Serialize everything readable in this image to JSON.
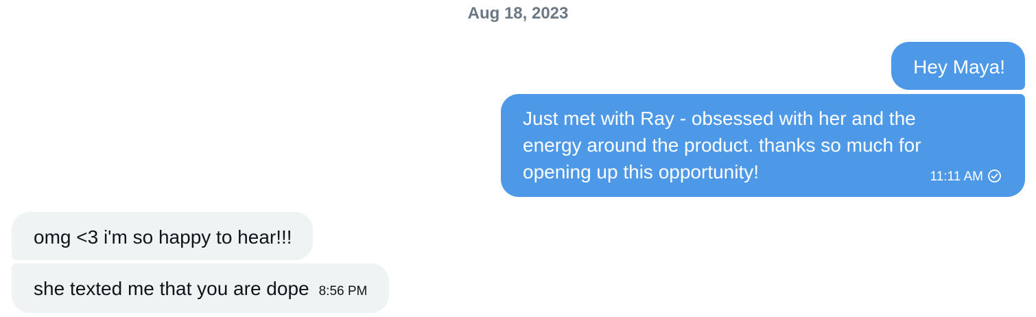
{
  "conversation": {
    "date_divider": "Aug 18, 2023",
    "messages": [
      {
        "direction": "outgoing",
        "text": "Hey Maya!"
      },
      {
        "direction": "outgoing",
        "text": "Just met with Ray - obsessed with her and the energy around the product. thanks so much for opening up this opportunity!",
        "time": "11:11 AM",
        "status_icon": "check-circle-icon"
      },
      {
        "direction": "incoming",
        "text": "omg <3 i'm so happy to hear!!!"
      },
      {
        "direction": "incoming",
        "text": "she texted me that you are dope",
        "time": "8:56 PM"
      }
    ]
  },
  "colors": {
    "outgoing_bubble": "#4d99e8",
    "incoming_bubble": "#eff3f4",
    "date_text": "#6b7883"
  }
}
